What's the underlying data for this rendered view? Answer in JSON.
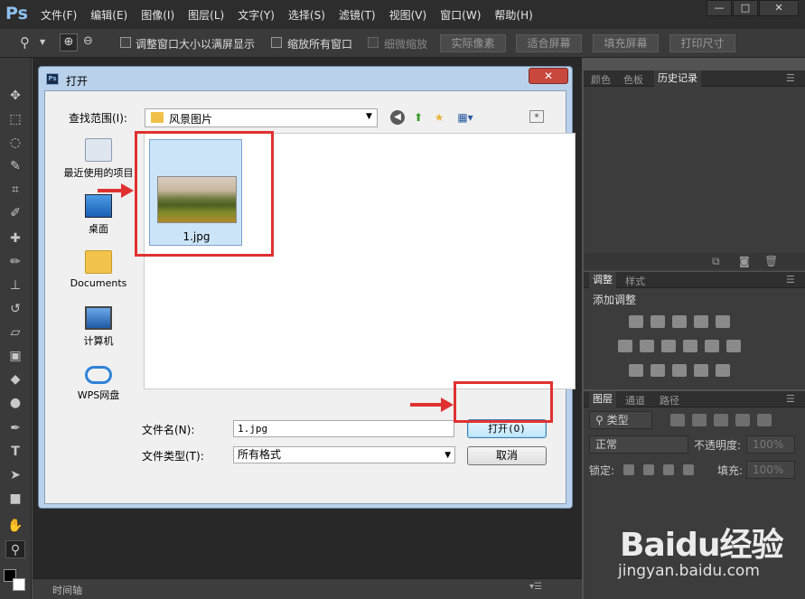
{
  "app": {
    "logo": "Ps",
    "menus": [
      "文件(F)",
      "编辑(E)",
      "图像(I)",
      "图层(L)",
      "文字(Y)",
      "选择(S)",
      "滤镜(T)",
      "视图(V)",
      "窗口(W)",
      "帮助(H)"
    ],
    "window_controls": [
      "—",
      "□",
      "✕"
    ]
  },
  "options_bar": {
    "resize_windows_label": "调整窗口大小以满屏显示",
    "zoom_all_label": "缩放所有窗口",
    "scrubby_zoom_label": "细微缩放",
    "actual_pixels": "实际像素",
    "fit_screen": "适合屏幕",
    "fill_screen": "填充屏幕",
    "print_size": "打印尺寸"
  },
  "timeline": {
    "label": "时间轴"
  },
  "panels": {
    "top_tabs": [
      "颜色",
      "色板",
      "历史记录"
    ],
    "adjust_tabs": [
      "调整",
      "样式"
    ],
    "add_adjustment": "添加调整",
    "layers_tabs": [
      "图层",
      "通道",
      "路径"
    ],
    "filter_kind": "类型",
    "blend_mode": "正常",
    "opacity_label": "不透明度:",
    "opacity_value": "100%",
    "lock_label": "锁定:",
    "fill_label": "填充:",
    "fill_value": "100%"
  },
  "dialog": {
    "title": "打开",
    "close": "✕",
    "look_in_label": "查找范围(I):",
    "look_in_value": "风景图片",
    "places": [
      "最近使用的项目",
      "桌面",
      "Documents",
      "计算机",
      "WPS网盘"
    ],
    "file": {
      "name": "1.jpg"
    },
    "filename_label": "文件名(N):",
    "filename_value": "1.jpg",
    "filetype_label": "文件类型(T):",
    "filetype_value": "所有格式",
    "open_button": "打开(O)",
    "cancel_button": "取消"
  },
  "watermark": {
    "logo": "Baidu经验",
    "url": "jingyan.baidu.com"
  },
  "colors": {
    "accent_red": "#e03131",
    "dialog_frame": "#b9d1ea",
    "app_dark": "#2d2d2d"
  }
}
